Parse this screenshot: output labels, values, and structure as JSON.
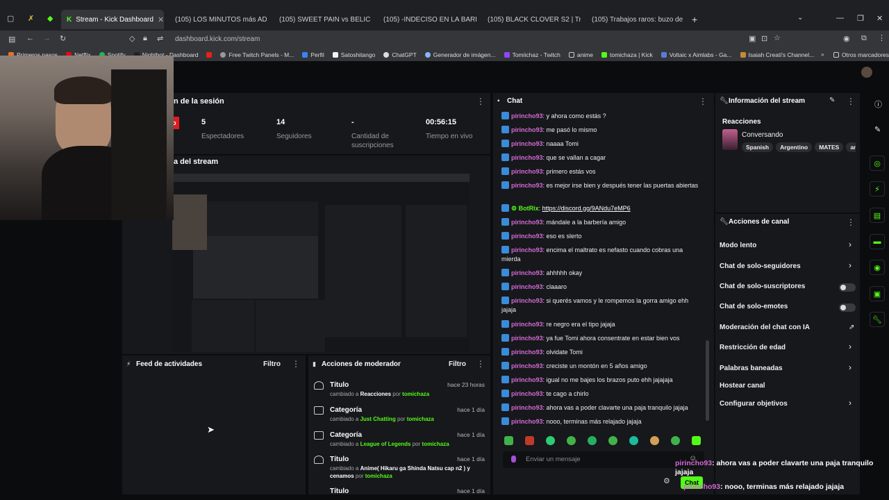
{
  "browser": {
    "tabs": [
      {
        "label": "Stream - Kick Dashboard",
        "active": true
      },
      {
        "label": "(105) LOS MINUTOS más ADICT",
        "active": false
      },
      {
        "label": "(105) SWEET PAIN vs BELIC",
        "active": false
      },
      {
        "label": "(105) -INDECISO EN LA BARBER",
        "active": false
      },
      {
        "label": "(105) BLACK CLOVER S2 | Trailer",
        "active": false
      },
      {
        "label": "(105) Trabajos raros: buzo de a",
        "active": false
      }
    ],
    "url": "dashboard.kick.com/stream",
    "bookmarks": [
      "Primeros pasos",
      "Netflix",
      "Spotify",
      "Nightbot - Dashboard",
      "Free Twitch Panels - M...",
      "Perfil",
      "Satoshitango",
      "ChatGPT",
      "Generador de imágen...",
      "Tomiichaz - Twitch",
      "anime",
      "tomichaza | Kick",
      "Voltaic x Aimlabs - Ga...",
      "Isaiah Creati's Channel..."
    ],
    "other_bookmarks": "Otros marcadores"
  },
  "session": {
    "title": "n de la sesión",
    "live_badge": "o",
    "stats": [
      {
        "value": "5",
        "label": "Espectadores"
      },
      {
        "value": "14",
        "label": "Seguidores"
      },
      {
        "value": "-",
        "label": "Cantidad de suscripciones"
      },
      {
        "value": "00:56:15",
        "label": "Tiempo en vivo"
      }
    ],
    "preview_title": "a del stream"
  },
  "activity": {
    "title": "Feed de actividades",
    "filter": "Filtro"
  },
  "moderator": {
    "title": "Acciones de moderador",
    "filter": "Filtro",
    "rows": [
      {
        "title": "Título",
        "time": "hace 23 horas",
        "prefix": "cambiado a",
        "value": "Reacciones",
        "by": "por",
        "user": "tomichaza",
        "icon": "user-icon"
      },
      {
        "title": "Categoría",
        "time": "hace 1 día",
        "prefix": "cambiado a",
        "value": "Just Chatting",
        "by": "por",
        "user": "tomichaza",
        "icon": "category-icon"
      },
      {
        "title": "Categoría",
        "time": "hace 1 día",
        "prefix": "cambiado a",
        "value": "League of Legends",
        "by": "por",
        "user": "tomichaza",
        "icon": "category-icon"
      },
      {
        "title": "Título",
        "time": "hace 1 día",
        "prefix": "cambiado a",
        "value": "Anime( Hikaru ga Shinda Natsu cap n2 ) y cenamos",
        "by": "por",
        "user": "tomichaza",
        "icon": "user-icon"
      },
      {
        "title": "Título",
        "time": "hace 1 día",
        "prefix": "",
        "value": "",
        "by": "",
        "user": "",
        "icon": "user-icon"
      }
    ]
  },
  "chat": {
    "title": "Chat",
    "input_placeholder": "Enviar un mensaje",
    "send_label": "Chat",
    "messages": [
      {
        "user": "pirincho93",
        "text": "y ahora como estás ?"
      },
      {
        "user": "pirincho93",
        "text": "me pasó lo mismo"
      },
      {
        "user": "pirincho93",
        "text": "naaaa Tomi"
      },
      {
        "user": "pirincho93",
        "text": "que se vallan a cagar"
      },
      {
        "user": "pirincho93",
        "text": "primero estás vos"
      },
      {
        "user": "pirincho93",
        "text": "es mejor irse bien y después tener las puertas abiertas"
      },
      {
        "user": "BotRix",
        "text": "https://discord.gg/9ANdu7eMP6",
        "bot": true
      },
      {
        "user": "pirincho93",
        "text": "mándale a la barbería amigo"
      },
      {
        "user": "pirincho93",
        "text": "eso es slerto"
      },
      {
        "user": "pirincho93",
        "text": "encima el maltrato es nefasto cuando cobras una mierda"
      },
      {
        "user": "pirincho93",
        "text": "ahhhhh okay"
      },
      {
        "user": "pirincho93",
        "text": "claaaro"
      },
      {
        "user": "pirincho93",
        "text": "si querés vamos y le rompemos la gorra amigo ehh jajaja"
      },
      {
        "user": "pirincho93",
        "text": "re negro era el tipo jajaja"
      },
      {
        "user": "pirincho93",
        "text": "ya fue Tomi ahora consentrate en estar bien vos"
      },
      {
        "user": "pirincho93",
        "text": "olvidate Tomi"
      },
      {
        "user": "pirincho93",
        "text": "creciste un montón en 5 años amigo"
      },
      {
        "user": "pirincho93",
        "text": "igual no me bajes los brazos puto ehh jajajaja"
      },
      {
        "user": "pirincho93",
        "text": "te cago a chirlo"
      },
      {
        "user": "pirincho93",
        "text": "ahora vas a poder clavarte una paja tranquilo jajaja"
      },
      {
        "user": "pirincho93",
        "text": "nooo, terminas más relajado jajaja"
      }
    ]
  },
  "stream_info": {
    "title": "Información del stream",
    "section": "Reacciones",
    "category": "Conversando",
    "tags": [
      "Spanish",
      "Argentino",
      "MATES",
      "ani"
    ]
  },
  "channel_actions": {
    "title": "Acciones de canal",
    "items": [
      {
        "label": "Modo lento",
        "control": "chevron"
      },
      {
        "label": "Chat de solo-seguidores",
        "control": "chevron"
      },
      {
        "label": "Chat de solo-suscriptores",
        "control": "toggle"
      },
      {
        "label": "Chat de solo-emotes",
        "control": "toggle"
      },
      {
        "label": "Moderación del chat con IA",
        "control": "external"
      },
      {
        "label": "Restricción de edad",
        "control": "chevron"
      },
      {
        "label": "Palabras baneadas",
        "control": "chevron"
      },
      {
        "label": "Hostear canal",
        "control": "none"
      },
      {
        "label": "Configurar objetivos",
        "control": "chevron"
      }
    ]
  },
  "overlay": {
    "messages": [
      {
        "user": "pirincho93",
        "text": "ahora vas a poder clavarte una paja tranquilo jajaja"
      },
      {
        "user": "pirincho93",
        "text": "nooo, terminas más relajado jajaja"
      }
    ]
  },
  "colors": {
    "accent": "#53fc18",
    "username": "#d36ad6",
    "panel": "#17181b",
    "background": "#0b0c0e"
  }
}
